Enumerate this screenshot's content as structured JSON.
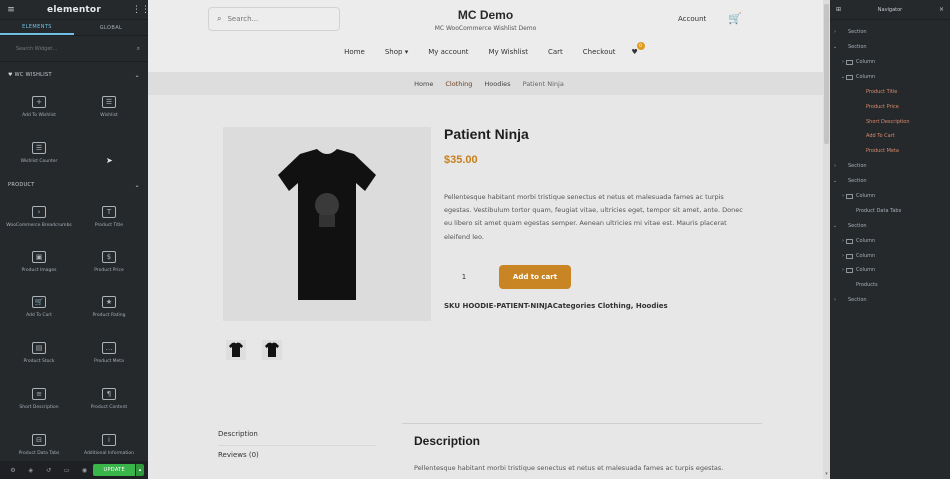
{
  "editor": {
    "logo": "elementor",
    "tabs": [
      "ELEMENTS",
      "GLOBAL"
    ],
    "search_placeholder": "Search Widget...",
    "categories": [
      "WC WISHLIST",
      "PRODUCT"
    ],
    "wishlist_widgets": [
      "Add To Wishlist",
      "Wishlist",
      "Wishlist Counter"
    ],
    "product_widgets": [
      "WooCommerce Breadcrumbs",
      "Product Title",
      "Product Images",
      "Product Price",
      "Add To Cart",
      "Product Rating",
      "Product Stock",
      "Product Meta",
      "Short Description",
      "Product Content",
      "Product Data Tabs",
      "Additional Information"
    ],
    "update_label": "UPDATE"
  },
  "site": {
    "search_placeholder": "Search...",
    "title": "MC Demo",
    "tagline": "MC WooCommerce Wishlist Demo",
    "account": "Account",
    "nav": [
      "Home",
      "Shop",
      "My account",
      "My Wishlist",
      "Cart",
      "Checkout"
    ],
    "wishlist_count": "0",
    "breadcrumb": [
      "Home",
      "Clothing",
      "Hoodies",
      "Patient Ninja"
    ]
  },
  "product": {
    "title": "Patient Ninja",
    "price": "$35.00",
    "short_description": "Pellentesque habitant morbi tristique senectus et netus et malesuada fames ac turpis egestas. Vestibulum tortor quam, feugiat vitae, ultricies eget, tempor sit amet, ante. Donec eu libero sit amet quam egestas semper. Aenean ultricies mi vitae est. Mauris placerat eleifend leo.",
    "quantity": "1",
    "add_to_cart": "Add to cart",
    "meta": "SKU HOODIE-PATIENT-NINJACategories Clothing, Hoodies",
    "tabs": [
      "Description",
      "Reviews (0)"
    ],
    "description_heading": "Description",
    "description_text": "Pellentesque habitant morbi tristique senectus et netus et malesuada fames ac turpis egestas."
  },
  "navigator": {
    "title": "Navigator",
    "rows": [
      "Section",
      "Section",
      "Column",
      "Column",
      "Product Title",
      "Product Price",
      "Short Description",
      "Add To Cart",
      "Product Meta",
      "Section",
      "Section",
      "Column",
      "Product Data Tabs",
      "Section",
      "Column",
      "Column",
      "Column",
      "Products",
      "Section"
    ]
  },
  "colors": {
    "panel_bg": "#26292c",
    "accent_blue": "#6ec1e4",
    "price_orange": "#c7801c",
    "update_green": "#39b54a",
    "navigator_highlight": "#d98a6b"
  }
}
